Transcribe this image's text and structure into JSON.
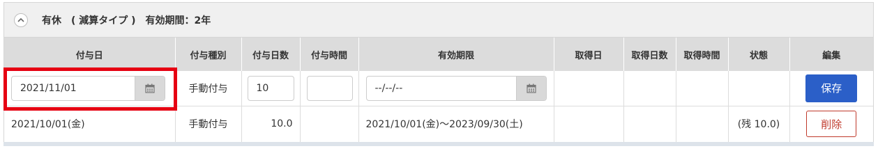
{
  "panel": {
    "title": "有休　( 減算タイプ )　有効期間：2年",
    "collapse_icon": "chevron-up-icon"
  },
  "columns": [
    "付与日",
    "付与種別",
    "付与日数",
    "付与時間",
    "有効期限",
    "取得日",
    "取得日数",
    "取得時間",
    "状態",
    "編集"
  ],
  "edit_row": {
    "grant_date": "2021/11/01",
    "grant_type": "手動付与",
    "grant_days": "10",
    "grant_time": "",
    "expiry_date": "--/--/--",
    "save_label": "保存"
  },
  "rows": [
    {
      "grant_date": "2021/10/01(金)",
      "grant_type": "手動付与",
      "grant_days": "10.0",
      "grant_time": "",
      "expiry": "2021/10/01(金)～2023/09/30(土)",
      "taken_date": "",
      "taken_days": "",
      "taken_time": "",
      "status": "(残 10.0)",
      "delete_label": "削除"
    }
  ],
  "colors": {
    "highlight": "#e60012",
    "save_button": "#2b5fc8",
    "delete_button": "#c0392b",
    "header_bg": "#dcdcdc"
  }
}
